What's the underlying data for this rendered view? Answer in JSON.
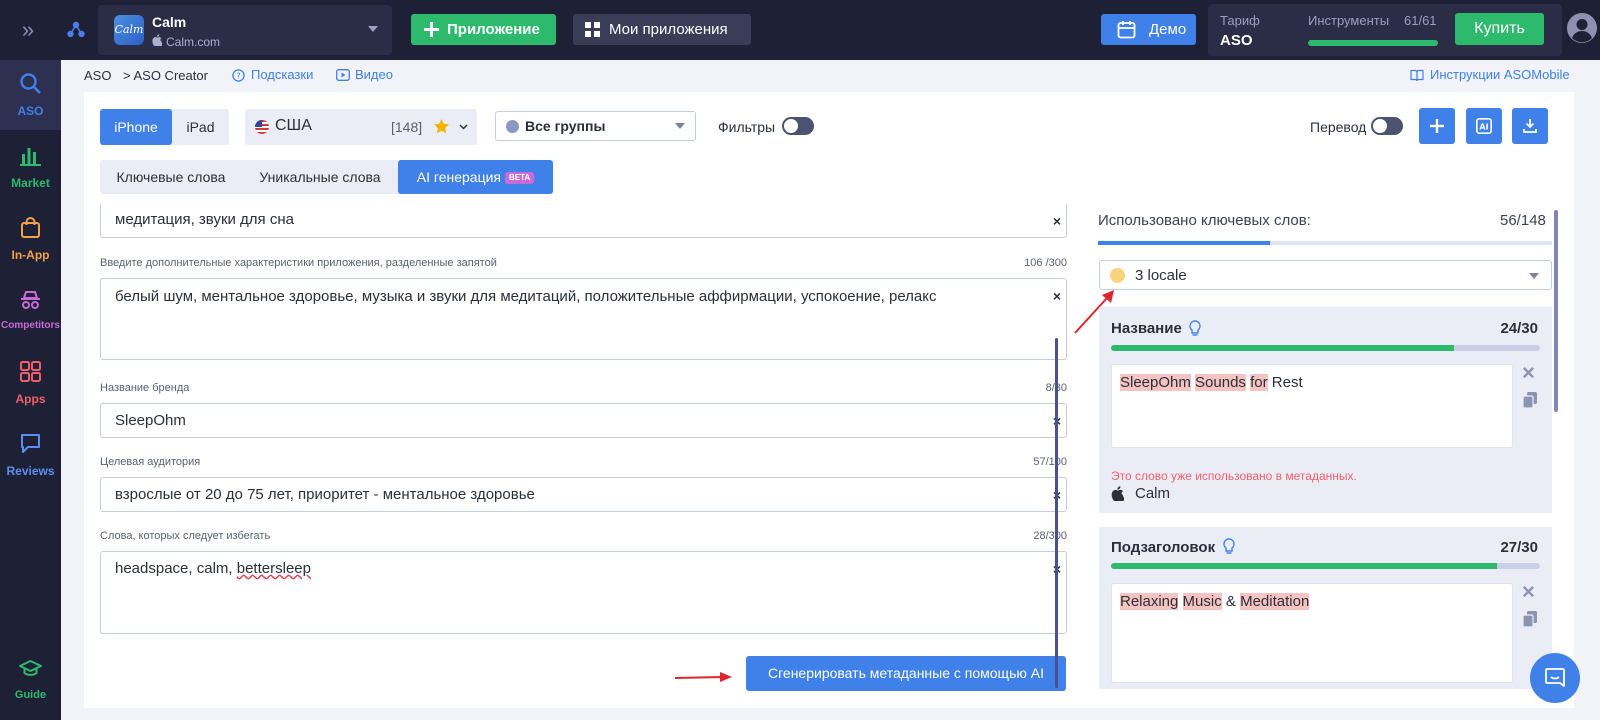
{
  "topbar": {
    "app": {
      "name": "Calm",
      "store_name": "Calm.com",
      "icon_text": "Calm"
    },
    "add_app_label": "Приложение",
    "my_apps_label": "Мои приложения",
    "demo_label": "Демо",
    "plan_label": "Тариф",
    "plan_value": "ASO",
    "tools_label": "Инструменты",
    "tools_count": "61/61",
    "tools_fraction": 1.0,
    "buy_label": "Купить"
  },
  "sidebar": {
    "items": [
      {
        "label": "ASO",
        "icon": "search-icon",
        "color": "#3f80e9"
      },
      {
        "label": "Market",
        "icon": "bar-chart-icon",
        "color": "#2dba6d"
      },
      {
        "label": "In-App",
        "icon": "shopping-bag-icon",
        "color": "#f0a24b"
      },
      {
        "label": "Competitors",
        "icon": "spy-icon",
        "color": "#c86ad8"
      },
      {
        "label": "Apps",
        "icon": "grid-icon",
        "color": "#f25f6a"
      },
      {
        "label": "Reviews",
        "icon": "chat-icon",
        "color": "#5a8ff0"
      },
      {
        "label": "Guide",
        "icon": "graduation-cap-icon",
        "color": "#2dba6d"
      }
    ]
  },
  "breadcrumb": {
    "root": "ASO",
    "current": "> ASO Creator",
    "hints": "Подсказки",
    "video": "Видео",
    "instructions": "Инструкции ASOMobile"
  },
  "toolbar": {
    "device_options": [
      "iPhone",
      "iPad"
    ],
    "device_selected": "iPhone",
    "country": "США",
    "country_count": "[148]",
    "groups_value": "Все группы",
    "filters_label": "Фильтры",
    "translate_label": "Перевод"
  },
  "tabs": [
    {
      "label": "Ключевые слова"
    },
    {
      "label": "Уникальные слова"
    },
    {
      "label": "AI генерация",
      "badge": "BETA",
      "active": true
    }
  ],
  "form": {
    "keywords_value": "медитация, звуки для сна",
    "features": {
      "label": "Введите дополнительные характеристики приложения, разделенные запятой",
      "count": "106 /300",
      "value": "белый шум, ментальное здоровье, музыка и звуки для медитаций, положительные аффирмации, успокоение, релакс"
    },
    "brand": {
      "label": "Название бренда",
      "count": "8/30",
      "value": "SleepOhm"
    },
    "audience": {
      "label": "Целевая аудитория",
      "count": "57/100",
      "value": "взрослые от 20 до 75 лет, приоритет - ментальное здоровье"
    },
    "avoid": {
      "label": "Слова, которых следует избегать",
      "count": "28/300",
      "value_prefix": "headspace, calm, ",
      "value_misspelled": "bettersleep"
    },
    "generate_label": "Сгенерировать метаданные с помощью AI"
  },
  "right_panel": {
    "used_label": "Использовано ключевых слов:",
    "used_count": "56/148",
    "used_fraction": 0.378,
    "locale": "3 locale",
    "title_card": {
      "title": "Название",
      "count": "24/30",
      "fraction": 0.8,
      "words": [
        {
          "text": "SleepOhm",
          "hl": true
        },
        {
          "text": "Sounds",
          "hl": true
        },
        {
          "text": "for",
          "hl": true
        },
        {
          "text": "Rest",
          "hl": false
        }
      ],
      "warning": "Это слово уже использовано в метаданных.",
      "source_app": "Calm"
    },
    "subtitle_card": {
      "title": "Подзаголовок",
      "count": "27/30",
      "fraction": 0.9,
      "words": [
        {
          "text": "Relaxing",
          "hl": true
        },
        {
          "text": "Music",
          "hl": true
        },
        {
          "text": "&",
          "hl": false
        },
        {
          "text": "Meditation",
          "hl": true
        }
      ]
    }
  }
}
